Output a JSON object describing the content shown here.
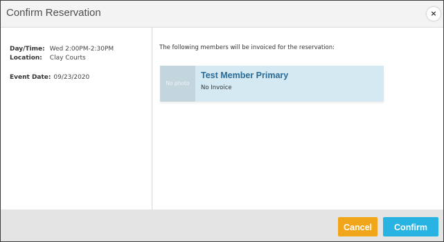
{
  "dialog": {
    "title": "Confirm Reservation",
    "close_label": "×"
  },
  "details": {
    "daytime_label": "Day/Time:",
    "daytime_value": "Wed 2:00PM-2:30PM",
    "location_label": "Location:",
    "location_value": "Clay Courts",
    "event_date_label": "Event Date:",
    "event_date_value": "09/23/2020"
  },
  "invoice": {
    "intro_text": "The following members will be invoiced for the reservation:",
    "members": [
      {
        "photo_text": "No photo",
        "name": "Test Member Primary",
        "status": "No Invoice"
      }
    ]
  },
  "footer": {
    "cancel_label": "Cancel",
    "confirm_label": "Confirm"
  },
  "colors": {
    "cancel_bg": "#f1a51b",
    "confirm_bg": "#29b3e2",
    "member_name": "#2a6a96",
    "card_bg": "#d4e9f2"
  },
  "icons": {
    "close": "close-icon"
  }
}
